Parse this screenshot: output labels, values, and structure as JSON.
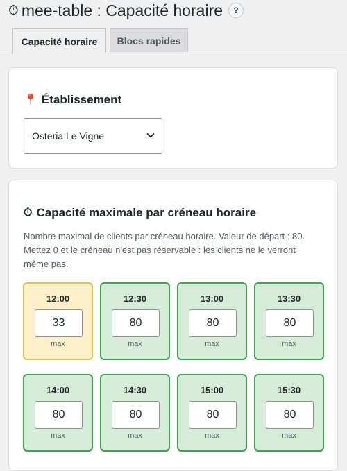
{
  "header": {
    "title_icon": "⏱",
    "title": "mee-table : Capacité horaire",
    "help_label": "?"
  },
  "tabs": [
    {
      "label": "Capacité horaire",
      "active": true
    },
    {
      "label": "Blocs rapides",
      "active": false
    }
  ],
  "establishment": {
    "icon": "📍",
    "heading": "Établissement",
    "selected": "Osteria Le Vigne"
  },
  "capacity": {
    "icon": "⏱",
    "heading": "Capacité maximale par créneau horaire",
    "description": "Nombre maximal de clients par créneau horaire. Valeur de départ : 80. Mettez 0 et le créneau n'est pas réservable : les clients ne le verront même pas.",
    "unit_label": "max",
    "slots": [
      {
        "time": "12:00",
        "value": "33",
        "status": "reduced"
      },
      {
        "time": "12:30",
        "value": "80",
        "status": "default"
      },
      {
        "time": "13:00",
        "value": "80",
        "status": "default"
      },
      {
        "time": "13:30",
        "value": "80",
        "status": "default"
      },
      {
        "time": "14:00",
        "value": "80",
        "status": "default"
      },
      {
        "time": "14:30",
        "value": "80",
        "status": "default"
      },
      {
        "time": "15:00",
        "value": "80",
        "status": "default"
      },
      {
        "time": "15:30",
        "value": "80",
        "status": "default"
      }
    ]
  },
  "colors": {
    "default_slot_bg": "#d5ecd9",
    "default_slot_border": "#3fa34d",
    "reduced_slot_bg": "#fdf0c8",
    "reduced_slot_border": "#e8c24a"
  }
}
